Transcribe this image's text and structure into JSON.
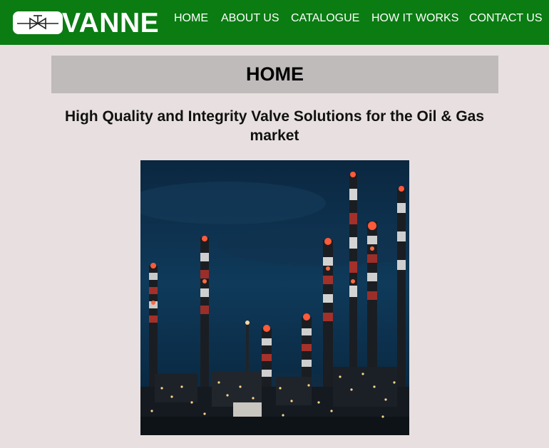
{
  "brand": {
    "name": "VANNE",
    "logo_icon": "valve-icon"
  },
  "nav": [
    {
      "label": "HOME"
    },
    {
      "label": "ABOUT US"
    },
    {
      "label": "CATALOGUE"
    },
    {
      "label": "HOW IT WORKS"
    },
    {
      "label": "CONTACT US"
    }
  ],
  "page": {
    "title": "HOME",
    "headline": "High Quality and Integrity Valve Solutions for the Oil & Gas market"
  },
  "colors": {
    "navbar": "#0a7c12",
    "background": "#e8e0e0",
    "title_bar": "#bfbbbb"
  }
}
